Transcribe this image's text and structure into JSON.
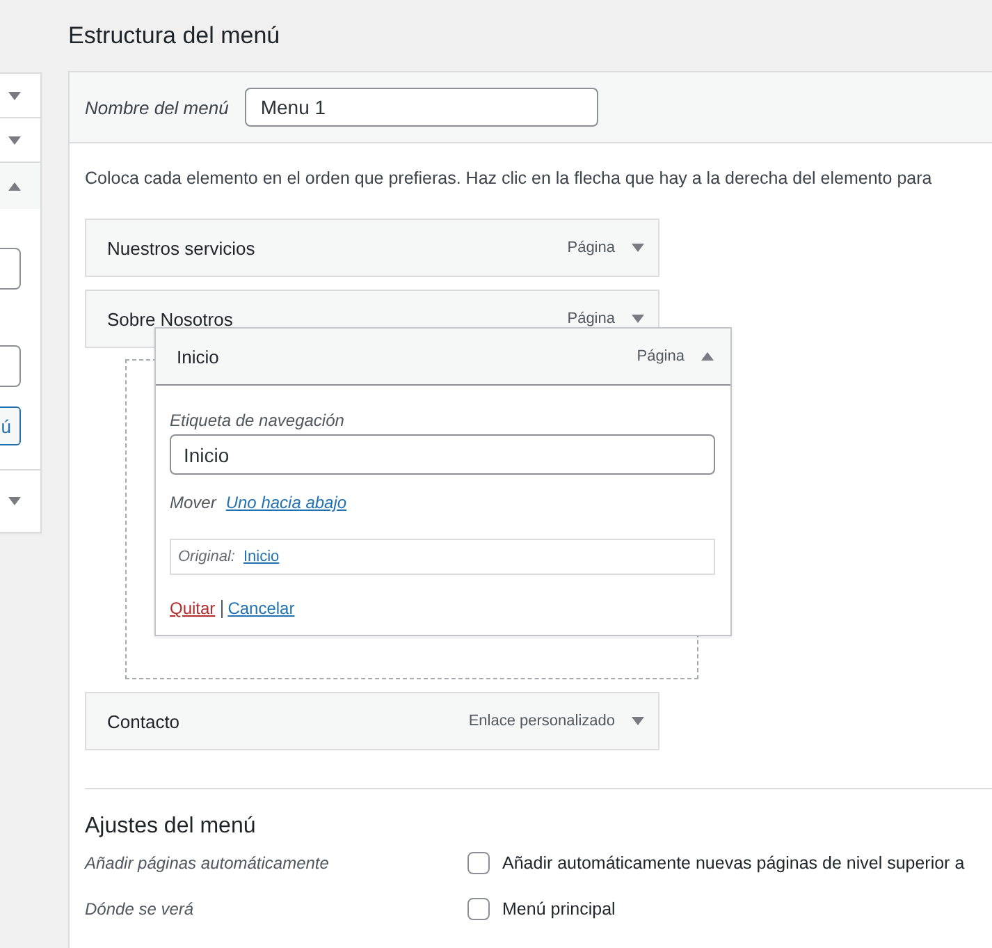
{
  "sidebar": {
    "sections": [
      {
        "expanded": false
      },
      {
        "expanded": false
      },
      {
        "expanded": true,
        "button": "ú"
      },
      {
        "expanded": false
      }
    ]
  },
  "title": "Estructura del menú",
  "menu_name": {
    "label": "Nombre del menú",
    "value": "Menu 1"
  },
  "instructions": "Coloca cada elemento en el orden que prefieras. Haz clic en la flecha que hay a la derecha del elemento para",
  "items": [
    {
      "title": "Nuestros servicios",
      "type": "Página",
      "expanded": false
    },
    {
      "title": "Sobre Nosotros",
      "type": "Página",
      "expanded": false
    },
    {
      "title": "Inicio",
      "type": "Página",
      "expanded": true,
      "nav_label": "Etiqueta de navegación",
      "nav_value": "Inicio",
      "move_label": "Mover",
      "move_link": "Uno hacia abajo",
      "original_label": "Original:",
      "original_link": "Inicio",
      "remove": "Quitar",
      "cancel": "Cancelar"
    },
    {
      "title": "Contacto",
      "type": "Enlace personalizado",
      "expanded": false
    }
  ],
  "settings": {
    "heading": "Ajustes del menú",
    "rows": [
      {
        "label": "Añadir páginas automáticamente",
        "option": "Añadir automáticamente nuevas páginas de nivel superior a",
        "checked": false
      },
      {
        "label": "Dónde se verá",
        "option": "Menú principal",
        "checked": false
      }
    ]
  }
}
